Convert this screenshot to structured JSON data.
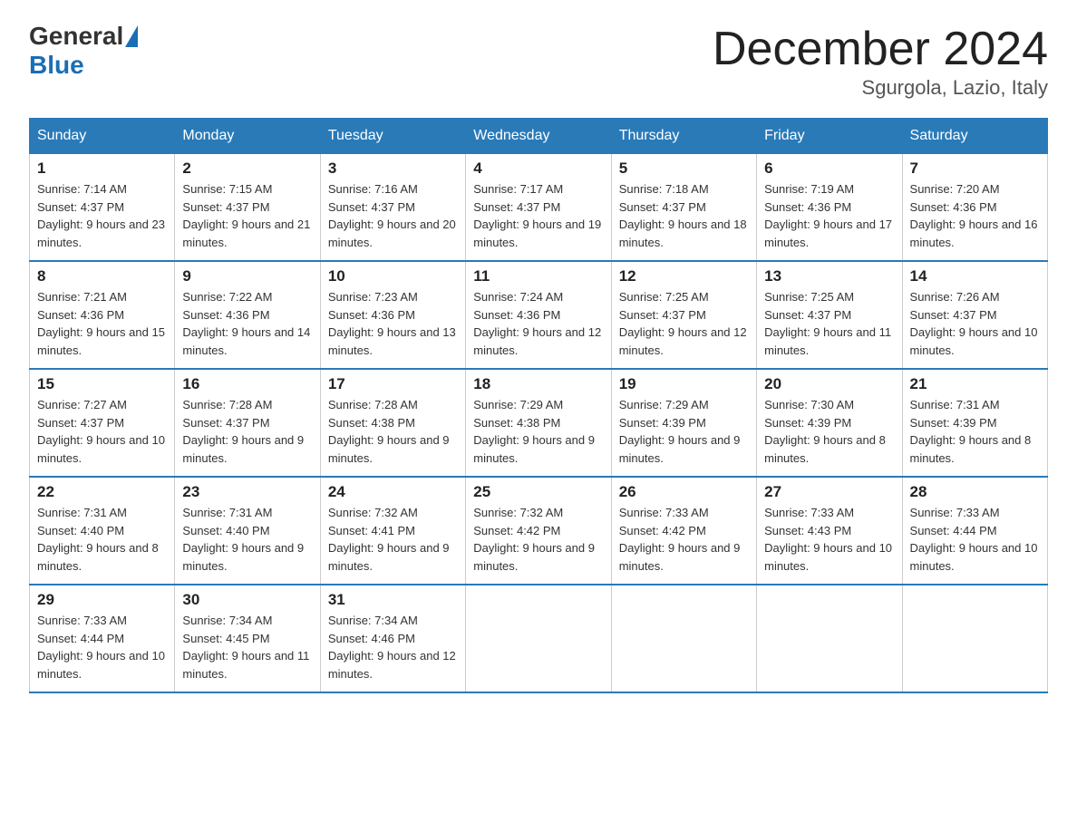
{
  "header": {
    "logo_general": "General",
    "logo_blue": "Blue",
    "month_title": "December 2024",
    "location": "Sgurgola, Lazio, Italy"
  },
  "days_of_week": [
    "Sunday",
    "Monday",
    "Tuesday",
    "Wednesday",
    "Thursday",
    "Friday",
    "Saturday"
  ],
  "weeks": [
    [
      {
        "day": "1",
        "sunrise": "Sunrise: 7:14 AM",
        "sunset": "Sunset: 4:37 PM",
        "daylight": "Daylight: 9 hours and 23 minutes."
      },
      {
        "day": "2",
        "sunrise": "Sunrise: 7:15 AM",
        "sunset": "Sunset: 4:37 PM",
        "daylight": "Daylight: 9 hours and 21 minutes."
      },
      {
        "day": "3",
        "sunrise": "Sunrise: 7:16 AM",
        "sunset": "Sunset: 4:37 PM",
        "daylight": "Daylight: 9 hours and 20 minutes."
      },
      {
        "day": "4",
        "sunrise": "Sunrise: 7:17 AM",
        "sunset": "Sunset: 4:37 PM",
        "daylight": "Daylight: 9 hours and 19 minutes."
      },
      {
        "day": "5",
        "sunrise": "Sunrise: 7:18 AM",
        "sunset": "Sunset: 4:37 PM",
        "daylight": "Daylight: 9 hours and 18 minutes."
      },
      {
        "day": "6",
        "sunrise": "Sunrise: 7:19 AM",
        "sunset": "Sunset: 4:36 PM",
        "daylight": "Daylight: 9 hours and 17 minutes."
      },
      {
        "day": "7",
        "sunrise": "Sunrise: 7:20 AM",
        "sunset": "Sunset: 4:36 PM",
        "daylight": "Daylight: 9 hours and 16 minutes."
      }
    ],
    [
      {
        "day": "8",
        "sunrise": "Sunrise: 7:21 AM",
        "sunset": "Sunset: 4:36 PM",
        "daylight": "Daylight: 9 hours and 15 minutes."
      },
      {
        "day": "9",
        "sunrise": "Sunrise: 7:22 AM",
        "sunset": "Sunset: 4:36 PM",
        "daylight": "Daylight: 9 hours and 14 minutes."
      },
      {
        "day": "10",
        "sunrise": "Sunrise: 7:23 AM",
        "sunset": "Sunset: 4:36 PM",
        "daylight": "Daylight: 9 hours and 13 minutes."
      },
      {
        "day": "11",
        "sunrise": "Sunrise: 7:24 AM",
        "sunset": "Sunset: 4:36 PM",
        "daylight": "Daylight: 9 hours and 12 minutes."
      },
      {
        "day": "12",
        "sunrise": "Sunrise: 7:25 AM",
        "sunset": "Sunset: 4:37 PM",
        "daylight": "Daylight: 9 hours and 12 minutes."
      },
      {
        "day": "13",
        "sunrise": "Sunrise: 7:25 AM",
        "sunset": "Sunset: 4:37 PM",
        "daylight": "Daylight: 9 hours and 11 minutes."
      },
      {
        "day": "14",
        "sunrise": "Sunrise: 7:26 AM",
        "sunset": "Sunset: 4:37 PM",
        "daylight": "Daylight: 9 hours and 10 minutes."
      }
    ],
    [
      {
        "day": "15",
        "sunrise": "Sunrise: 7:27 AM",
        "sunset": "Sunset: 4:37 PM",
        "daylight": "Daylight: 9 hours and 10 minutes."
      },
      {
        "day": "16",
        "sunrise": "Sunrise: 7:28 AM",
        "sunset": "Sunset: 4:37 PM",
        "daylight": "Daylight: 9 hours and 9 minutes."
      },
      {
        "day": "17",
        "sunrise": "Sunrise: 7:28 AM",
        "sunset": "Sunset: 4:38 PM",
        "daylight": "Daylight: 9 hours and 9 minutes."
      },
      {
        "day": "18",
        "sunrise": "Sunrise: 7:29 AM",
        "sunset": "Sunset: 4:38 PM",
        "daylight": "Daylight: 9 hours and 9 minutes."
      },
      {
        "day": "19",
        "sunrise": "Sunrise: 7:29 AM",
        "sunset": "Sunset: 4:39 PM",
        "daylight": "Daylight: 9 hours and 9 minutes."
      },
      {
        "day": "20",
        "sunrise": "Sunrise: 7:30 AM",
        "sunset": "Sunset: 4:39 PM",
        "daylight": "Daylight: 9 hours and 8 minutes."
      },
      {
        "day": "21",
        "sunrise": "Sunrise: 7:31 AM",
        "sunset": "Sunset: 4:39 PM",
        "daylight": "Daylight: 9 hours and 8 minutes."
      }
    ],
    [
      {
        "day": "22",
        "sunrise": "Sunrise: 7:31 AM",
        "sunset": "Sunset: 4:40 PM",
        "daylight": "Daylight: 9 hours and 8 minutes."
      },
      {
        "day": "23",
        "sunrise": "Sunrise: 7:31 AM",
        "sunset": "Sunset: 4:40 PM",
        "daylight": "Daylight: 9 hours and 9 minutes."
      },
      {
        "day": "24",
        "sunrise": "Sunrise: 7:32 AM",
        "sunset": "Sunset: 4:41 PM",
        "daylight": "Daylight: 9 hours and 9 minutes."
      },
      {
        "day": "25",
        "sunrise": "Sunrise: 7:32 AM",
        "sunset": "Sunset: 4:42 PM",
        "daylight": "Daylight: 9 hours and 9 minutes."
      },
      {
        "day": "26",
        "sunrise": "Sunrise: 7:33 AM",
        "sunset": "Sunset: 4:42 PM",
        "daylight": "Daylight: 9 hours and 9 minutes."
      },
      {
        "day": "27",
        "sunrise": "Sunrise: 7:33 AM",
        "sunset": "Sunset: 4:43 PM",
        "daylight": "Daylight: 9 hours and 10 minutes."
      },
      {
        "day": "28",
        "sunrise": "Sunrise: 7:33 AM",
        "sunset": "Sunset: 4:44 PM",
        "daylight": "Daylight: 9 hours and 10 minutes."
      }
    ],
    [
      {
        "day": "29",
        "sunrise": "Sunrise: 7:33 AM",
        "sunset": "Sunset: 4:44 PM",
        "daylight": "Daylight: 9 hours and 10 minutes."
      },
      {
        "day": "30",
        "sunrise": "Sunrise: 7:34 AM",
        "sunset": "Sunset: 4:45 PM",
        "daylight": "Daylight: 9 hours and 11 minutes."
      },
      {
        "day": "31",
        "sunrise": "Sunrise: 7:34 AM",
        "sunset": "Sunset: 4:46 PM",
        "daylight": "Daylight: 9 hours and 12 minutes."
      },
      {
        "day": "",
        "sunrise": "",
        "sunset": "",
        "daylight": ""
      },
      {
        "day": "",
        "sunrise": "",
        "sunset": "",
        "daylight": ""
      },
      {
        "day": "",
        "sunrise": "",
        "sunset": "",
        "daylight": ""
      },
      {
        "day": "",
        "sunrise": "",
        "sunset": "",
        "daylight": ""
      }
    ]
  ]
}
